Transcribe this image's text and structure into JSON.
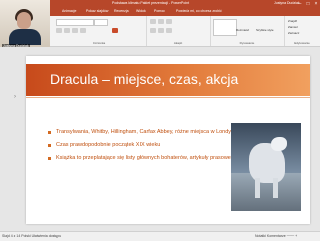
{
  "titlebar": {
    "title": "Podstawa klimatu Pakiet prezentacji - PowerPoint",
    "user": "Justyna Dudziak"
  },
  "tabs": [
    {
      "label": "Animacje"
    },
    {
      "label": "Pokaz slajdów"
    },
    {
      "label": "Recenzja"
    },
    {
      "label": "Widok"
    },
    {
      "label": "Pomoc"
    }
  ],
  "tellme": "Powiedz mi, co chcesz zrobić",
  "ribbon": {
    "group_font": "Czcionka",
    "group_paragraph": "Akapit",
    "group_drawing": "Rysowanie",
    "group_editing": "Edytowanie",
    "shapes_label": "Kształty",
    "arrange_label": "Rozmieść",
    "styles_label": "Szybkie style",
    "find_label": "Znajdź",
    "replace_label": "Zamień",
    "select_label": "Zaznacz"
  },
  "webcam": {
    "name": "Justyna Dudziak"
  },
  "slide": {
    "title": "Dracula – miejsce, czas, akcja",
    "bullets": [
      "Transylwania, Whitby, Hillingham, Carfax Abbey, różne miejsca w Londynie",
      "Czas prawdopodobnie początek XIX wieku",
      "Książka to przeplatające się listy głównych bohaterów, artykuły prasowe, depesze"
    ]
  },
  "status": {
    "left": "Slajd 4 z 14   Polski   Ułatwienia dostępu",
    "right": "Notatki   Komentarze   ─── +"
  },
  "colors": {
    "accent": "#b7472a",
    "header_start": "#c74a1b",
    "bullet_text": "#c0500f"
  }
}
